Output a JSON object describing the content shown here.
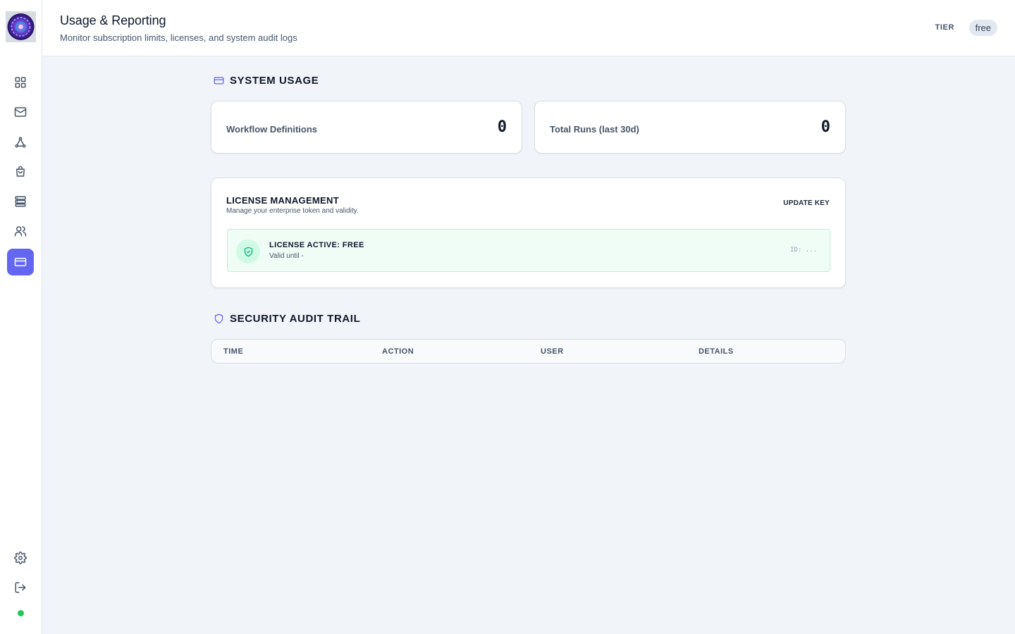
{
  "header": {
    "title": "Usage & Reporting",
    "subtitle": "Monitor subscription limits, licenses, and system audit logs",
    "tier_label": "TIER",
    "tier_value": "free"
  },
  "sidebar": {
    "items": [
      {
        "name": "dashboard",
        "icon": "grid-icon"
      },
      {
        "name": "inbox",
        "icon": "mail-icon"
      },
      {
        "name": "workflows",
        "icon": "network-icon"
      },
      {
        "name": "marketplace",
        "icon": "shopping-bag-icon"
      },
      {
        "name": "servers",
        "icon": "server-icon"
      },
      {
        "name": "users",
        "icon": "users-icon"
      },
      {
        "name": "billing",
        "icon": "credit-card-icon",
        "active": true
      }
    ],
    "bottom": [
      {
        "name": "settings",
        "icon": "gear-icon"
      },
      {
        "name": "logout",
        "icon": "logout-icon"
      }
    ],
    "status": "online"
  },
  "usage": {
    "section_title": "SYSTEM USAGE",
    "stats": [
      {
        "label": "Workflow Definitions",
        "value": "0"
      },
      {
        "label": "Total Runs (last 30d)",
        "value": "0"
      }
    ]
  },
  "license": {
    "title": "LICENSE MANAGEMENT",
    "description": "Manage your enterprise token and validity.",
    "update_label": "UPDATE KEY",
    "status_title": "LICENSE ACTIVE: FREE",
    "valid_until": "Valid until -",
    "id_text": "ID: ..."
  },
  "audit": {
    "section_title": "SECURITY AUDIT TRAIL",
    "columns": [
      "TIME",
      "ACTION",
      "USER",
      "DETAILS"
    ]
  },
  "colors": {
    "accent": "#6366f1",
    "success": "#10b981",
    "status_dot": "#22c55e",
    "background": "#f1f4f9"
  }
}
